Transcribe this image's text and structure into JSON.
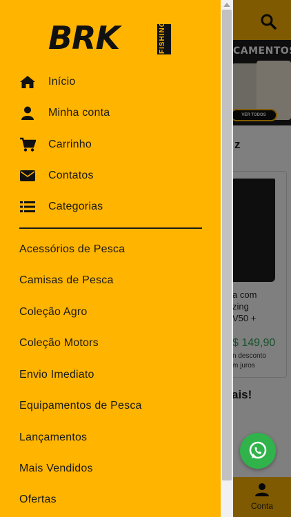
{
  "drawer": {
    "logo": {
      "main": "BRK",
      "sub": "FISHING"
    },
    "menu": [
      {
        "label": "Início",
        "icon": "home-icon"
      },
      {
        "label": "Minha conta",
        "icon": "user-icon"
      },
      {
        "label": "Carrinho",
        "icon": "cart-icon"
      },
      {
        "label": "Contatos",
        "icon": "envelope-icon"
      },
      {
        "label": "Categorias",
        "icon": "list-icon"
      }
    ],
    "categories": [
      "Acessórios de Pesca",
      "Camisas de Pesca",
      "Coleção Agro",
      "Coleção Motors",
      "Envio Imediato",
      "Equipamentos de Pesca",
      "Lançamentos",
      "Mais Vendidos",
      "Ofertas"
    ]
  },
  "background": {
    "banner": {
      "title": "CAMENTOS",
      "cta": "VER TODOS"
    },
    "section_title": "z",
    "product": {
      "name_lines": [
        "a com",
        "zing",
        "V50 +"
      ],
      "price": "$ 149,90",
      "note1": "n desconto",
      "note2": "m juros"
    },
    "section2_title": "ais!",
    "bottom_nav": {
      "account_label": "Conta"
    }
  },
  "colors": {
    "brand": "#ffb400",
    "text": "#1a1a1a",
    "price": "#2aa354",
    "whatsapp": "#2fb34a"
  }
}
